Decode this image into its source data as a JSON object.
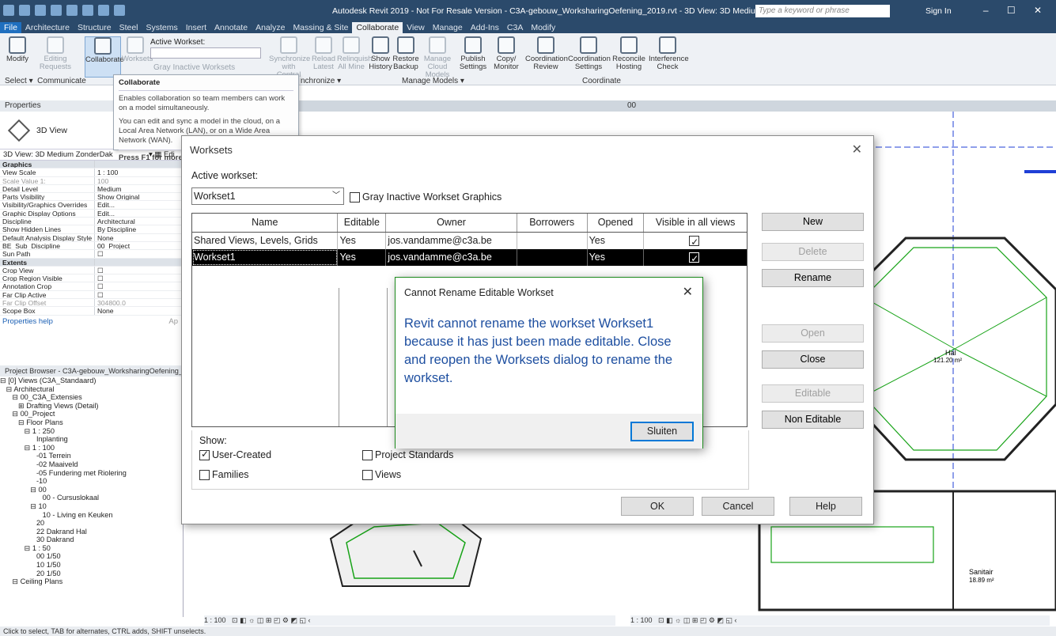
{
  "app": {
    "title": "Autodesk Revit 2019 - Not For Resale Version - C3A-gebouw_WorksharingOefening_2019.rvt - 3D View: 3D Medium ZonderDak",
    "search_placeholder": "Type a keyword or phrase",
    "sign_in": "Sign In"
  },
  "menu": [
    "File",
    "Architecture",
    "Structure",
    "Steel",
    "Systems",
    "Insert",
    "Annotate",
    "Analyze",
    "Massing & Site",
    "Collaborate",
    "View",
    "Manage",
    "Add-Ins",
    "C3A",
    "Modify"
  ],
  "ribbon": {
    "modify": "Modify",
    "editing_requests": "Editing Requests",
    "collaborate": "Collaborate",
    "worksets": "Worksets",
    "active_workset_label": "Active Workset:",
    "gray_inactive": "Gray Inactive Worksets",
    "synchronize": "Synchronize with Central",
    "reload": "Reload Latest",
    "relinquish": "Relinquish All Mine",
    "show_history": "Show History",
    "restore_backup": "Restore Backup",
    "manage_cloud": "Manage Cloud Models",
    "publish_settings": "Publish Settings",
    "copy_monitor": "Copy/ Monitor",
    "coord_review": "Coordination Review",
    "coord_settings": "Coordination Settings",
    "reconcile": "Reconcile Hosting",
    "interference": "Interference Check",
    "panel_select": "Select",
    "panel_communicate": "Communicate",
    "panel_synchronize": "nchronize",
    "panel_manage_models": "Manage Models",
    "panel_coordinate": "Coordinate"
  },
  "tooltip": {
    "title": "Collaborate",
    "line1": "Enables collaboration so team members can work on a model simultaneously.",
    "line2": "You can edit and sync a model in the cloud, on a Local Area Network (LAN), or on a Wide Area Network (WAN).",
    "f1": "Press F1 for more h"
  },
  "properties": {
    "header": "Properties",
    "type_name": "3D View",
    "view_selector": "3D View: 3D Medium ZonderDak",
    "edit_type": "Edi",
    "rows": [
      {
        "k": "Graphics",
        "v": "",
        "group": true
      },
      {
        "k": "View Scale",
        "v": "1 : 100"
      },
      {
        "k": "Scale Value    1:",
        "v": "100",
        "dim": true
      },
      {
        "k": "Detail Level",
        "v": "Medium"
      },
      {
        "k": "Parts Visibility",
        "v": "Show Original"
      },
      {
        "k": "Visibility/Graphics Overrides",
        "v": "Edit..."
      },
      {
        "k": "Graphic Display Options",
        "v": "Edit..."
      },
      {
        "k": "Discipline",
        "v": "Architectural"
      },
      {
        "k": "Show Hidden Lines",
        "v": "By Discipline"
      },
      {
        "k": "Default Analysis Display Style",
        "v": "None"
      },
      {
        "k": "BE_Sub_Discipline",
        "v": "00_Project"
      },
      {
        "k": "Sun Path",
        "v": "☐"
      },
      {
        "k": "Extents",
        "v": "",
        "group": true
      },
      {
        "k": "Crop View",
        "v": "☐"
      },
      {
        "k": "Crop Region Visible",
        "v": "☐"
      },
      {
        "k": "Annotation Crop",
        "v": "☐"
      },
      {
        "k": "Far Clip Active",
        "v": "☐"
      },
      {
        "k": "Far Clip Offset",
        "v": "304800.0",
        "dim": true
      },
      {
        "k": "Scope Box",
        "v": "None"
      }
    ],
    "help": "Properties help",
    "apply": "Ap"
  },
  "browser": {
    "header": "Project Browser - C3A-gebouw_WorksharingOefening_2019",
    "tree": [
      "⊟ [0] Views (C3A_Standaard)",
      "   ⊟ Architectural",
      "      ⊟ 00_C3A_Extensies",
      "         ⊞ Drafting Views (Detail)",
      "      ⊟ 00_Project",
      "         ⊟ Floor Plans",
      "            ⊟ 1 : 250",
      "                  Inplanting",
      "            ⊟ 1 : 100",
      "                  -01 Terrein",
      "                  -02 Maaiveld",
      "                  -05 Fundering met Riolering",
      "                  -10",
      "               ⊟ 00",
      "                     00 - Cursuslokaal",
      "               ⊟ 10",
      "                     10 - Living en Keuken",
      "                  20",
      "                  22 Dakrand Hal",
      "                  30 Dakrand",
      "            ⊟ 1 : 50",
      "                  00 1/50",
      "                  10 1/50",
      "                  20 1/50",
      "      ⊟ Ceiling Plans"
    ]
  },
  "view": {
    "tab_00": "00",
    "scale_left": "1 : 100",
    "scale_right": "1 : 100",
    "hal_label": "Hal",
    "hal_area": "121.20 m²",
    "sanitair_label": "Sanitair",
    "sanitair_area": "18.89 m²"
  },
  "statusbar": "Click to select, TAB for alternates, CTRL adds, SHIFT unselects.",
  "worksets_dialog": {
    "title": "Worksets",
    "active_label": "Active workset:",
    "active_value": "Workset1",
    "gray_label": "Gray Inactive Workset Graphics",
    "columns": [
      "Name",
      "Editable",
      "Owner",
      "Borrowers",
      "Opened",
      "Visible in all views"
    ],
    "rows": [
      {
        "name": "Shared Views, Levels, Grids",
        "editable": "Yes",
        "owner": "jos.vandamme@c3a.be",
        "borrowers": "",
        "opened": "Yes",
        "visible": true
      },
      {
        "name": "Workset1",
        "editable": "Yes",
        "owner": "jos.vandamme@c3a.be",
        "borrowers": "",
        "opened": "Yes",
        "visible": true
      }
    ],
    "buttons": {
      "new": "New",
      "delete": "Delete",
      "rename": "Rename",
      "open": "Open",
      "close": "Close",
      "editable": "Editable",
      "non_editable": "Non Editable",
      "ok": "OK",
      "cancel": "Cancel",
      "help": "Help"
    },
    "show_label": "Show:",
    "show": {
      "user_created": "User-Created",
      "families": "Families",
      "project_standards": "Project Standards",
      "views": "Views"
    }
  },
  "error_dialog": {
    "title": "Cannot Rename Editable Workset",
    "message": "Revit cannot rename the workset Workset1 because it has just been made editable. Close and reopen the Worksets dialog to rename the workset.",
    "button": "Sluiten"
  },
  "colors": {
    "title_bg": "#2b4a6b",
    "selected_row": "#000000",
    "error_text": "#1e4fa0",
    "error_border": "#1c8a1c",
    "plan_green": "#17a317",
    "grid_blue": "#1f3fd6"
  }
}
